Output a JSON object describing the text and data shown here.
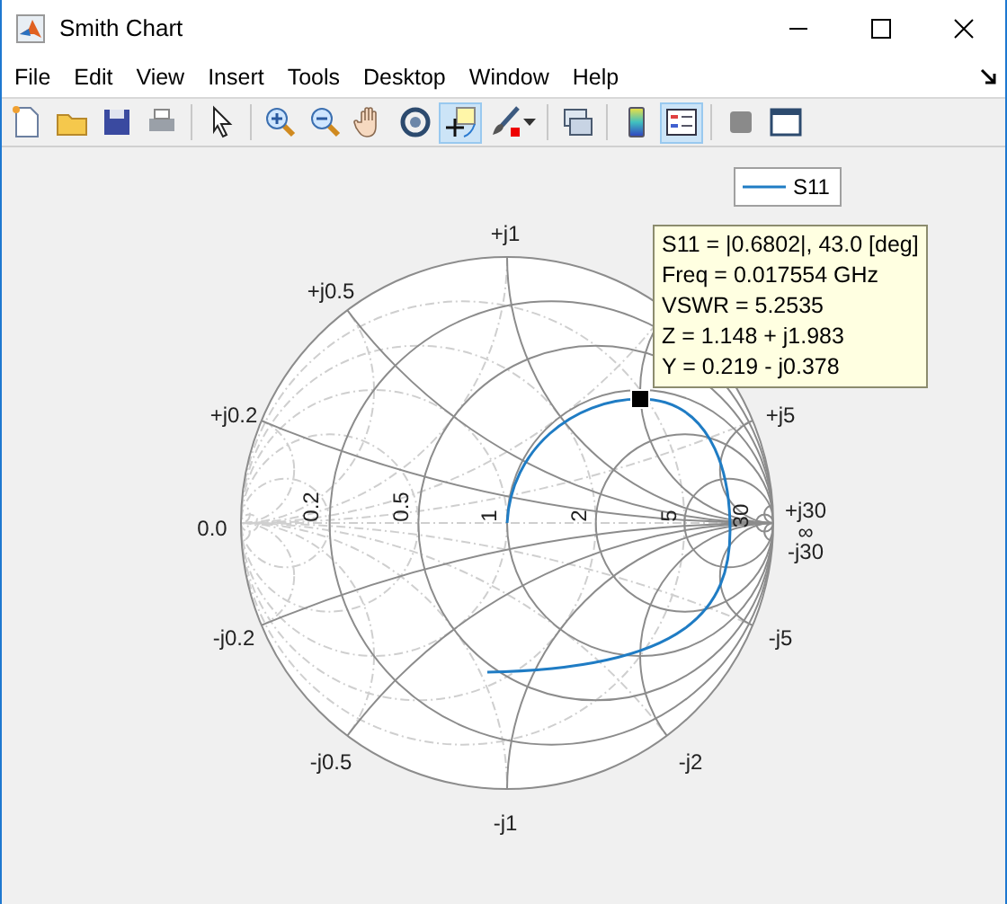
{
  "window": {
    "title": "Smith Chart"
  },
  "menu": [
    "File",
    "Edit",
    "View",
    "Insert",
    "Tools",
    "Desktop",
    "Window",
    "Help"
  ],
  "toolbar": [
    [
      {
        "kind": "new",
        "selected": false
      },
      {
        "kind": "open",
        "selected": false
      },
      {
        "kind": "save",
        "selected": false
      },
      {
        "kind": "print",
        "selected": false
      }
    ],
    [
      {
        "kind": "pointer",
        "selected": false
      }
    ],
    [
      {
        "kind": "zoomin",
        "selected": false
      },
      {
        "kind": "zoomout",
        "selected": false
      },
      {
        "kind": "pan",
        "selected": false
      },
      {
        "kind": "rotate",
        "selected": false
      },
      {
        "kind": "cursor",
        "selected": true
      },
      {
        "kind": "brush",
        "selected": false
      }
    ],
    [
      {
        "kind": "link",
        "selected": false
      }
    ],
    [
      {
        "kind": "colorbar",
        "selected": false
      },
      {
        "kind": "legend",
        "selected": true
      }
    ],
    [
      {
        "kind": "square",
        "selected": false
      },
      {
        "kind": "dock",
        "selected": false
      }
    ]
  ],
  "legend": {
    "label": "S11"
  },
  "datatip": [
    "S11 = |0.6802|, 43.0 [deg]",
    "Freq = 0.017554 GHz",
    "VSWR = 5.2535",
    "Z = 1.148 + j1.983",
    "Y = 0.219 - j0.378"
  ],
  "resistance_labels": [
    "0.0",
    "0.2",
    "0.5",
    "1",
    "2",
    "5",
    "30",
    "∞"
  ],
  "reactance_labels": [
    "+j1",
    "+j0.5",
    "+j0.2",
    "+j5",
    "+j30",
    "-j30",
    "-j0.2",
    "-j0.5",
    "-j1",
    "-j2",
    "-j5"
  ]
}
